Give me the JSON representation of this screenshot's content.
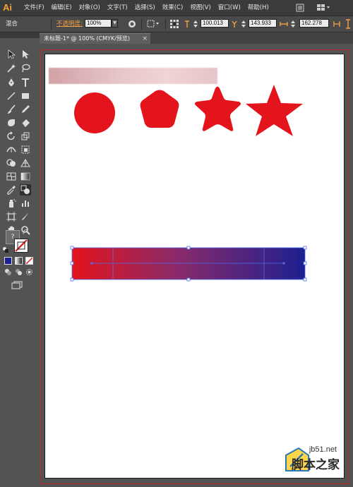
{
  "app": {
    "logo": "Ai"
  },
  "menu": {
    "items": [
      "文件(F)",
      "编辑(E)",
      "对象(O)",
      "文字(T)",
      "选择(S)",
      "效果(C)",
      "视图(V)",
      "窗口(W)",
      "帮助(H)"
    ]
  },
  "control_bar": {
    "selection_label": "混合",
    "opacity_label": "不透明度:",
    "opacity_value": "100%",
    "x_value": "100.013",
    "y_value": "143.933",
    "w_value": "162.278"
  },
  "document": {
    "tab_title": "未标题-1* @ 100% (CMYK/预览)",
    "tab_close": "×"
  },
  "toolbox": {
    "color_mode_label": "?"
  },
  "artwork": {
    "shape_color": "#e3141c",
    "gradient_start": "#e3141c",
    "gradient_end": "#1d2090",
    "shapes": [
      "circle",
      "rounded-pentagon",
      "rounded-star",
      "star"
    ]
  },
  "watermark": {
    "url": "jb51.net",
    "cn_text": "脚本之家"
  },
  "colors": {
    "accent": "#f7a23a",
    "selection": "#4f6ee8",
    "artboard_border": "#c1272d"
  }
}
